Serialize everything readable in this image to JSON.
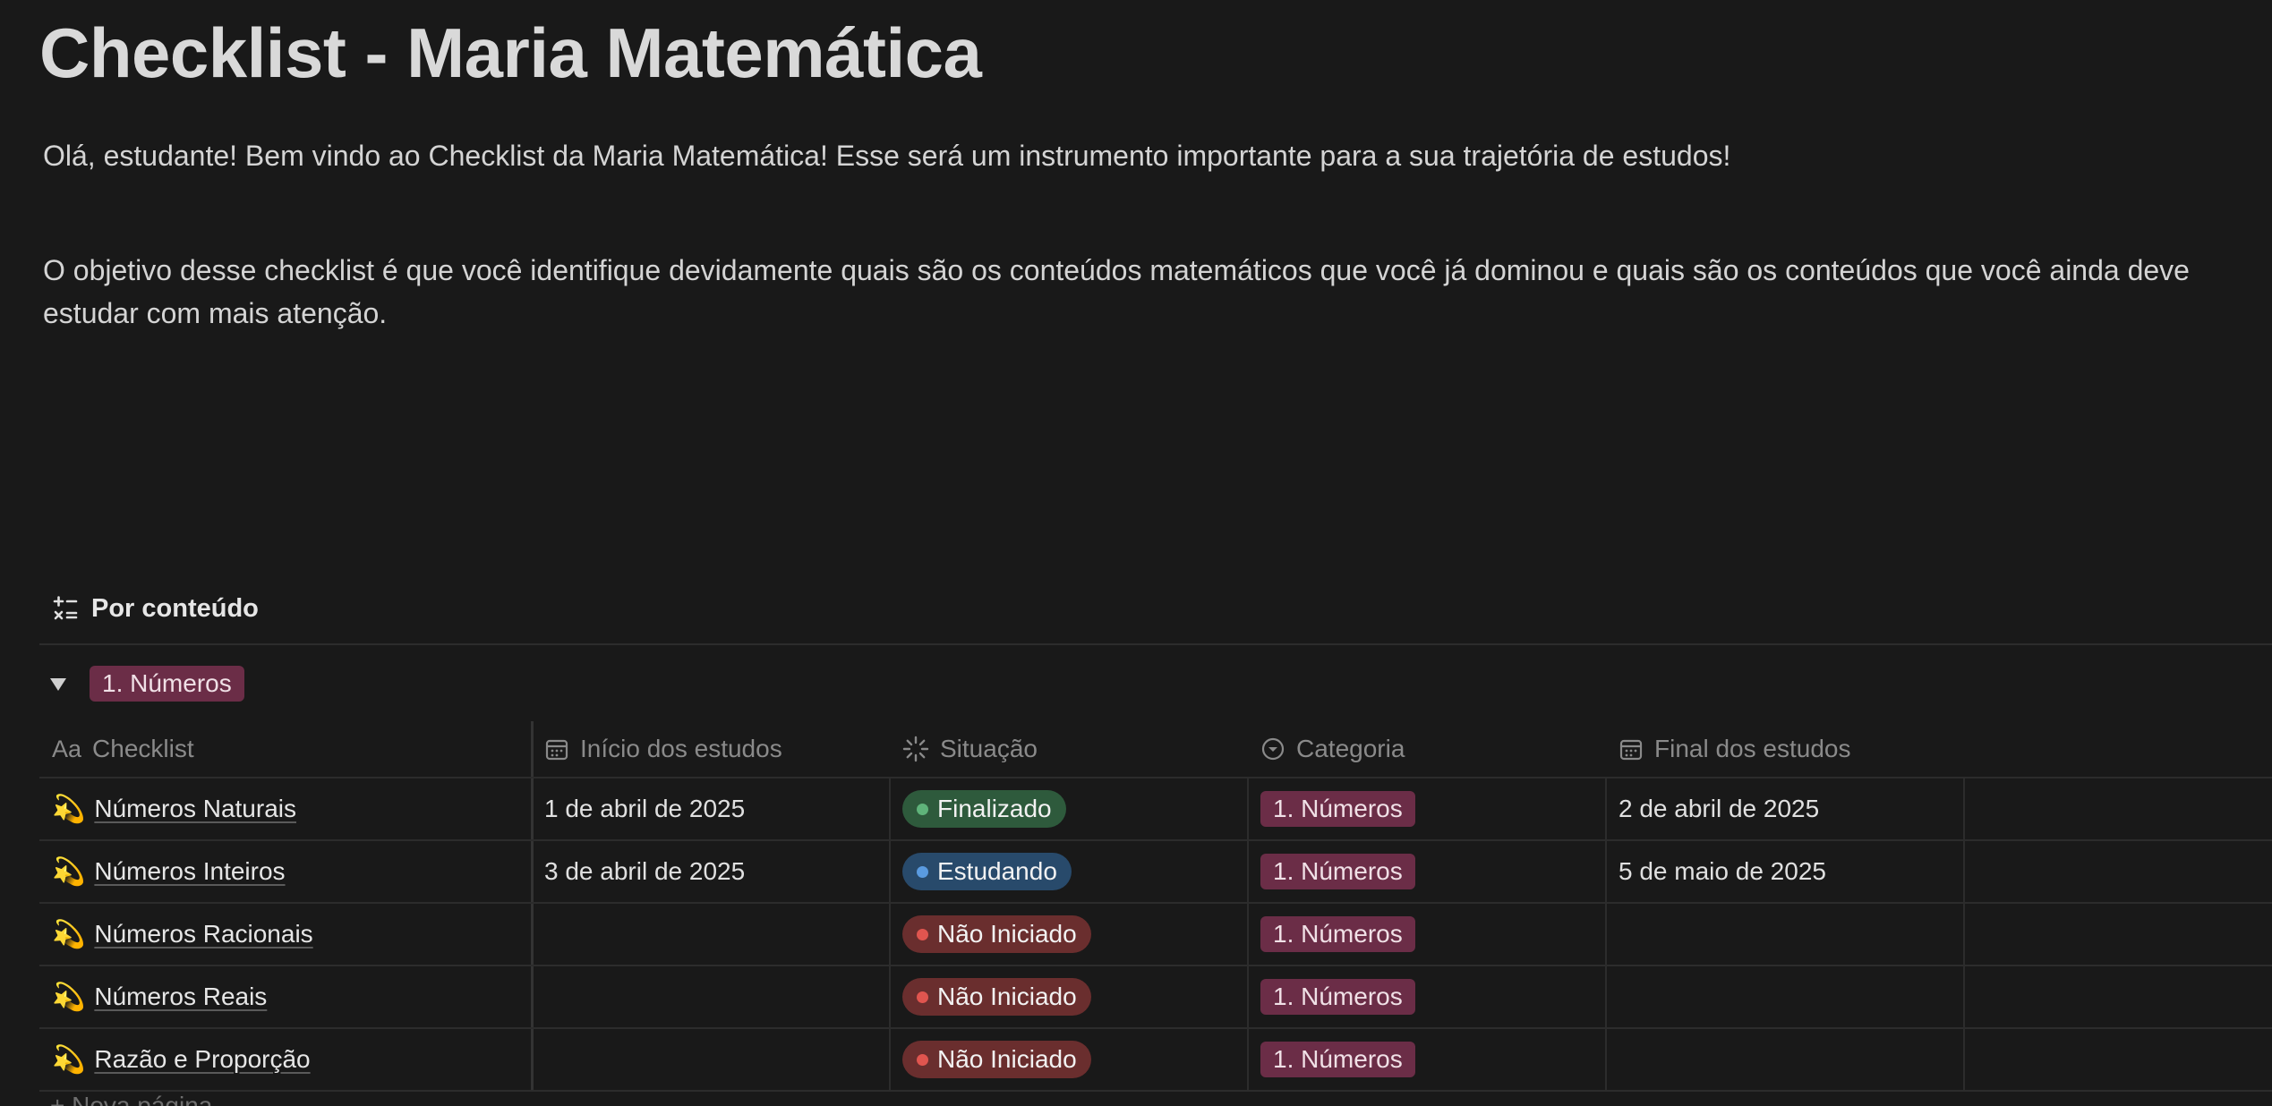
{
  "page": {
    "title": "Checklist - Maria Matemática",
    "intro": "Olá, estudante! Bem vindo ao Checklist da Maria Matemática! Esse será um instrumento importante para a sua trajetória de estudos!",
    "objective": "O objetivo desse checklist é que você identifique devidamente quais são os conteúdos matemáticos que você já dominou e quais são os conteúdos que você ainda deve estudar com mais atenção."
  },
  "view": {
    "tab_label": "Por conteúdo"
  },
  "group": {
    "label": "1. Números"
  },
  "columns": {
    "checklist": "Checklist",
    "checklist_prefix": "Aa",
    "start": "Início dos estudos",
    "status": "Situação",
    "category": "Categoria",
    "end": "Final dos estudos"
  },
  "rows": [
    {
      "icon": "💫",
      "name": "Números Naturais",
      "start": "1 de abril de 2025",
      "status": "Finalizado",
      "status_kind": "done",
      "category": "1. Números",
      "end": "2 de abril de 2025"
    },
    {
      "icon": "💫",
      "name": "Números Inteiros",
      "start": "3 de abril de 2025",
      "status": "Estudando",
      "status_kind": "study",
      "category": "1. Números",
      "end": "5 de maio de 2025"
    },
    {
      "icon": "💫",
      "name": "Números Racionais",
      "start": "",
      "status": "Não Iniciado",
      "status_kind": "none",
      "category": "1. Números",
      "end": ""
    },
    {
      "icon": "💫",
      "name": "Números Reais",
      "start": "",
      "status": "Não Iniciado",
      "status_kind": "none",
      "category": "1. Números",
      "end": ""
    },
    {
      "icon": "💫",
      "name": "Razão e Proporção",
      "start": "",
      "status": "Não Iniciado",
      "status_kind": "none",
      "category": "1. Números",
      "end": ""
    }
  ],
  "footer": {
    "new_page": "+ Nova página"
  },
  "colors": {
    "background": "#191919",
    "tag": "#6b2d47",
    "done": "#2e5a3c",
    "study": "#284a6b",
    "not_started": "#6a2e2e"
  },
  "icons": {
    "view": "calculator-ops-icon",
    "start": "calendar-icon",
    "status": "loading-spinner-icon",
    "category": "select-chevron-icon",
    "end": "calendar-icon",
    "row": "dizzy-star-emoji"
  }
}
